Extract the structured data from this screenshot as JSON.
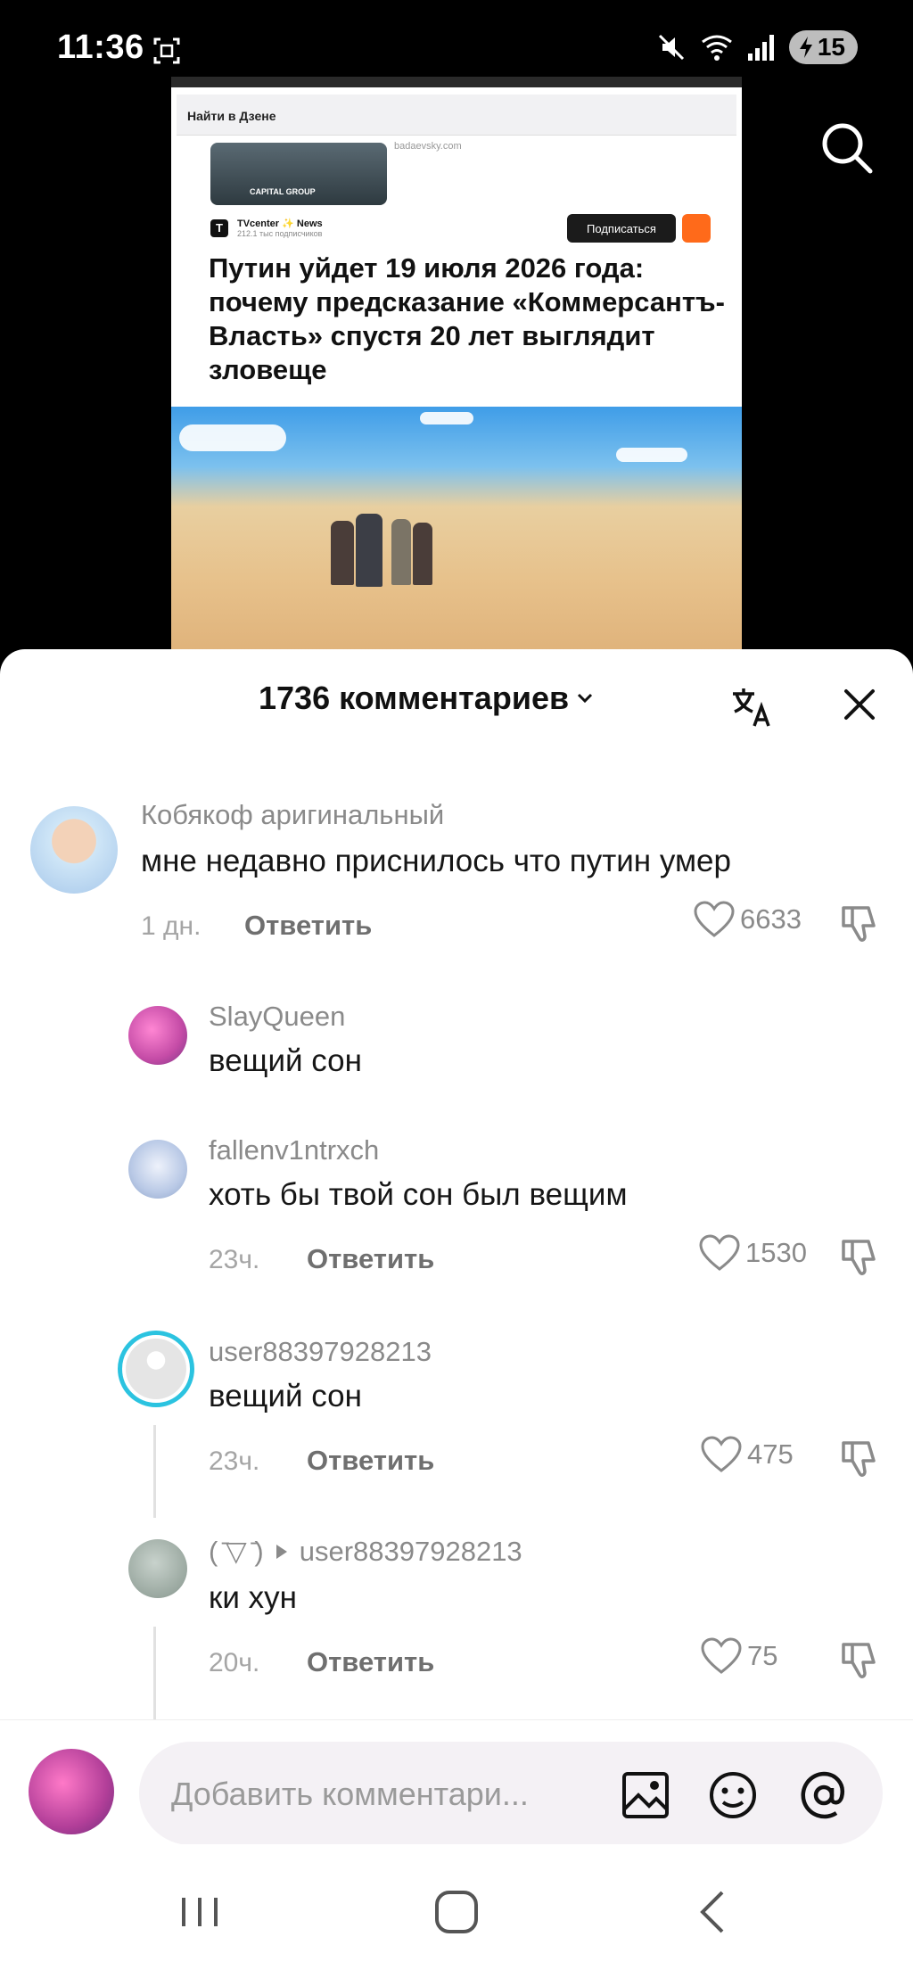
{
  "status_bar": {
    "time": "11:36",
    "battery": "15"
  },
  "video": {
    "search_label": "Найти в Дзене",
    "url": "badaevsky.com",
    "thumb_label": "CAPITAL GROUP",
    "channel_name": "TVcenter ✨ News",
    "channel_subs": "212.1 тыс подписчиков",
    "subscribe_label": "Подписаться",
    "headline": "Путин уйдет 19 июля 2026 года: почему предсказание «Коммерсантъ-Власть» спустя 20 лет выглядит зловеще"
  },
  "comments_header": {
    "title": "1736 комментариев"
  },
  "comments": [
    {
      "user": "Кобякоф аригинальный",
      "text": "мне недавно приснилось что путин умер",
      "time": "1 дн.",
      "reply_label": "Ответить",
      "likes": "6633"
    },
    {
      "user": "SlayQueen",
      "text": "вещий сон"
    },
    {
      "user": "fallenv1ntrxch",
      "text": "хоть бы твой сон был вещим",
      "time": "23ч.",
      "reply_label": "Ответить",
      "likes": "1530"
    },
    {
      "user": "user88397928213",
      "text": "вещий сон",
      "time": "23ч.",
      "reply_label": "Ответить",
      "likes": "475"
    },
    {
      "user": "( ̄▽ ̄)",
      "reply_to": "user88397928213",
      "text": "ки хун",
      "time": "20ч.",
      "reply_label": "Ответить",
      "likes": "75"
    }
  ],
  "input": {
    "placeholder": "Добавить комментари..."
  },
  "colors": {
    "accent_ring": "#2bc3e0",
    "sheet_bg": "#ffffff",
    "orange": "#ff6a1a"
  }
}
